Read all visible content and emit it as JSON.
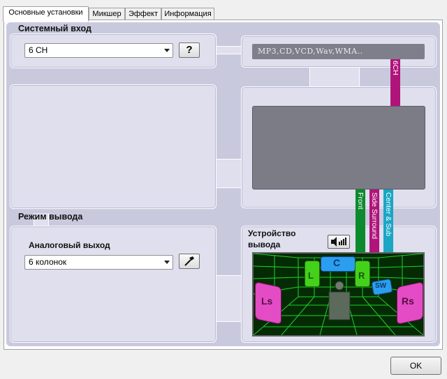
{
  "tabs": [
    {
      "label": "Основные установки",
      "active": true
    },
    {
      "label": "Микшер",
      "active": false
    },
    {
      "label": "Эффект",
      "active": false
    },
    {
      "label": "Информация",
      "active": false
    }
  ],
  "input": {
    "section_label": "Системный вход",
    "select_value": "6 CH",
    "help_label": "?",
    "source_text": "MP3,CD,VCD,Wav,WMA..",
    "channel_tag": "6CH"
  },
  "output": {
    "section_label": "Режим вывода",
    "analog_label": "Аналоговый выход",
    "select_value": "6 колонок",
    "device_label_line1": "Устройство",
    "device_label_line2": "вывода"
  },
  "channels": [
    {
      "label": "Front",
      "color": "#0d8a2d"
    },
    {
      "label": "Side Surround",
      "color": "#b0147a"
    },
    {
      "label": "Center & Sub",
      "color": "#1aa6c4"
    }
  ],
  "speakers": {
    "front_left": "L",
    "center": "C",
    "front_right": "R",
    "subwoofer": "SW",
    "surround_left": "Ls",
    "surround_right": "Rs"
  },
  "footer": {
    "ok_label": "OK"
  },
  "colors": {
    "panel": "#dfdfee",
    "frame": "#c9c9de",
    "grid": "#1fd12a",
    "magenta": "#e34cc4",
    "green": "#44d11a"
  }
}
